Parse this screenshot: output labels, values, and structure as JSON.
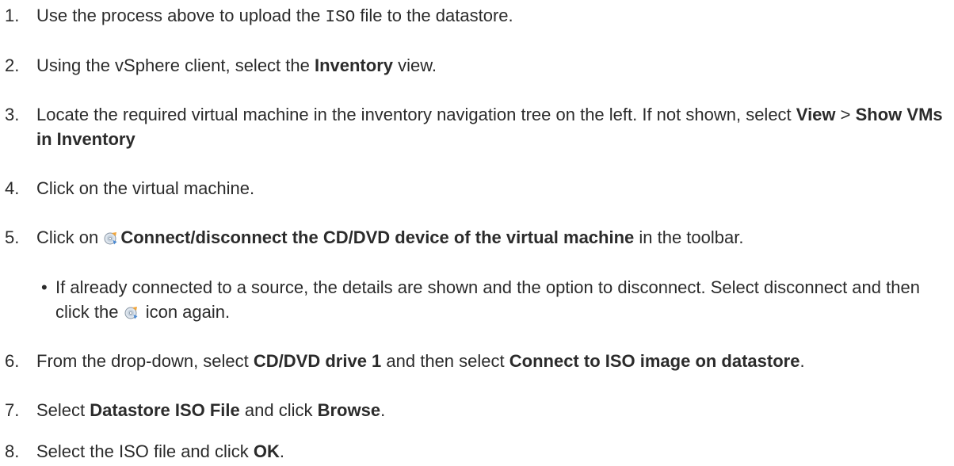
{
  "steps": [
    {
      "num": "1.",
      "a": "Use the process above to upload the ",
      "code": "ISO",
      "b": " file to the datastore."
    },
    {
      "num": "2.",
      "a": "Using the vSphere client, select the ",
      "bold": "Inventory",
      "b": " view."
    },
    {
      "num": "3.",
      "a": "Locate the required virtual machine in the inventory navigation tree on the left. If not shown, select ",
      "bold1": "View",
      "sep": " > ",
      "bold2": "Show VMs in Inventory"
    },
    {
      "num": "4.",
      "a": "Click on the virtual machine."
    },
    {
      "num": "5.",
      "a": "Click on ",
      "icon": "cd-dvd-connect-icon",
      "bold": "Connect/disconnect the CD/DVD device of the virtual machine",
      "b": " in the toolbar."
    },
    {
      "num": "6.",
      "a": "From the drop-down, select ",
      "bold1": "CD/DVD drive 1",
      "mid": " and then select ",
      "bold2": "Connect to ISO image on datastore",
      "end": "."
    },
    {
      "num": "7.",
      "a": "Select ",
      "bold1": "Datastore ISO File",
      "mid": " and click ",
      "bold2": "Browse",
      "end": "."
    },
    {
      "num": "8.",
      "a": "Select the ISO file and click ",
      "bold": "OK",
      "end": "."
    }
  ],
  "sub_bullet": {
    "marker": "•",
    "a": "If already connected to a source, the details are shown and the option to disconnect. Select disconnect and then click the ",
    "icon": "cd-dvd-connect-icon",
    "b": " icon again."
  }
}
